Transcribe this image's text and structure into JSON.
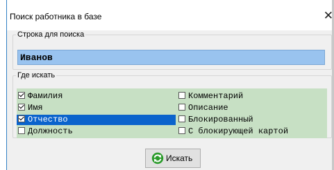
{
  "window": {
    "title": "Поиск работника в базе",
    "close_glyph": "✕"
  },
  "search": {
    "group_label": "Строка для поиска",
    "value": "Иванов"
  },
  "where": {
    "group_label": "Где искать",
    "options": [
      {
        "label": "Фамилия",
        "checked": true,
        "selected": false
      },
      {
        "label": "Имя",
        "checked": true,
        "selected": false
      },
      {
        "label": "Отчество",
        "checked": true,
        "selected": true
      },
      {
        "label": "Должность",
        "checked": false,
        "selected": false
      },
      {
        "label": "Комментарий",
        "checked": false,
        "selected": false
      },
      {
        "label": "Описание",
        "checked": false,
        "selected": false
      },
      {
        "label": "Блокированный",
        "checked": false,
        "selected": false
      },
      {
        "label": "С блокирующей картой",
        "checked": false,
        "selected": false
      }
    ]
  },
  "button": {
    "label": "Искать",
    "icon": "refresh-icon"
  },
  "colors": {
    "options_bg": "#c7e0c4",
    "selection": "#0a63cc",
    "search_bg": "#99c3ef",
    "icon_green": "#2a9b2a"
  }
}
